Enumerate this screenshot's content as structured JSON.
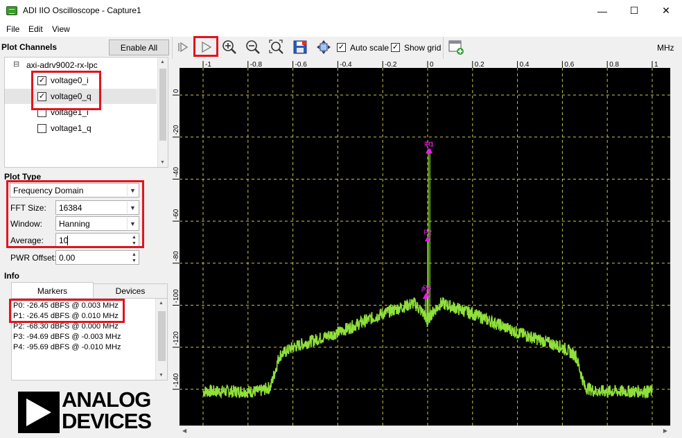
{
  "window": {
    "title": "ADI IIO Oscilloscope - Capture1",
    "min": "—",
    "max": "☐",
    "close": "✕"
  },
  "menu": [
    "File",
    "Edit",
    "View"
  ],
  "plot_channels": {
    "title": "Plot Channels",
    "enable_all": "Enable All",
    "device": "axi-adrv9002-rx-lpc",
    "expander": "⊟",
    "channels": [
      {
        "label": "voltage0_i",
        "checked": true
      },
      {
        "label": "voltage0_q",
        "checked": true
      },
      {
        "label": "voltage1_i",
        "checked": false
      },
      {
        "label": "voltage1_q",
        "checked": false
      }
    ]
  },
  "plot_type": {
    "title": "Plot Type",
    "domain": "Frequency Domain",
    "fft_size_label": "FFT Size:",
    "fft_size": "16384",
    "window_label": "Window:",
    "window": "Hanning",
    "average_label": "Average:",
    "average": "10",
    "pwr_offset_label": "PWR Offset:",
    "pwr_offset": "0.00"
  },
  "info": {
    "title": "Info",
    "tabs": [
      "Markers",
      "Devices"
    ],
    "markers": [
      "P0: -26.45 dBFS @ 0.003 MHz",
      "P1: -26.45 dBFS @ 0.010 MHz",
      "P2: -68.30 dBFS @ 0.000 MHz",
      "P3: -94.69 dBFS @ -0.003 MHz",
      "P4: -95.69 dBFS @ -0.010 MHz"
    ]
  },
  "logo": {
    "line1": "ANALOG",
    "line2": "DEVICES"
  },
  "toolbar": {
    "auto_scale": "Auto scale",
    "auto_scale_checked": true,
    "show_grid": "Show grid",
    "show_grid_checked": true,
    "unit": "MHz"
  },
  "colors": {
    "trace": "#8fe03a",
    "marker": "#e020e0",
    "grid": "#c8c84a",
    "plot_bg": "#000000",
    "highlight": "#e0141e"
  },
  "chart_data": {
    "type": "line",
    "xlim": [
      -1,
      1
    ],
    "ylim": [
      -150,
      5
    ],
    "x_ticks": [
      "-1",
      "-0.8",
      "-0.6",
      "-0.4",
      "-0.2",
      "0",
      "0.2",
      "0.4",
      "0.6",
      "0.8",
      "1"
    ],
    "y_ticks": [
      "0",
      "-20",
      "-40",
      "-60",
      "-80",
      "-100",
      "-120",
      "-140"
    ],
    "x_unit": "MHz",
    "series": [
      {
        "x": [
          -1.0,
          -0.75,
          -0.7,
          -0.66,
          -0.6,
          -0.4,
          -0.2,
          -0.06,
          -0.01,
          0.0,
          0.01,
          0.06,
          0.2,
          0.4,
          0.6,
          0.66,
          0.7,
          0.75,
          1.0
        ],
        "y": [
          -141,
          -141,
          -139,
          -124,
          -120,
          -113,
          -104,
          -99,
          -105,
          -109,
          -105,
          -99,
          -104,
          -113,
          -120,
          -124,
          -139,
          -141,
          -141
        ]
      }
    ],
    "markers": [
      {
        "label": "P0",
        "x": 0.003,
        "y": -26.45
      },
      {
        "label": "P1",
        "x": 0.01,
        "y": -26.45
      },
      {
        "label": "P2",
        "x": 0.0,
        "y": -68.3
      },
      {
        "label": "P3",
        "x": -0.003,
        "y": -94.69
      },
      {
        "label": "P4",
        "x": -0.01,
        "y": -95.69
      }
    ]
  }
}
